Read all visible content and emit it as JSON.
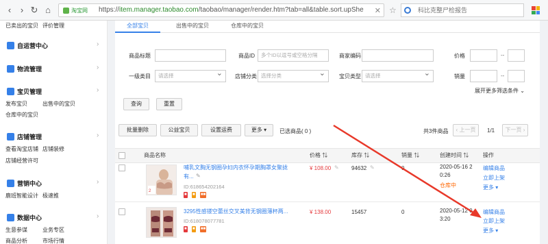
{
  "browser": {
    "site_name": "淘宝网",
    "url_prefix": "https://",
    "url_domain": "item.manager.taobao.com",
    "url_path": "/taobao/manager/render.htm?tab=all&table.sort.upShe",
    "search_text": "科比克整尸检报告"
  },
  "sidebar": {
    "top_links": [
      "已卖出的宝贝",
      "评价管理"
    ],
    "sections": [
      {
        "title": "自运营中心"
      },
      {
        "title": "物流管理"
      },
      {
        "title": "宝贝管理",
        "links": [
          "发布宝贝",
          "出售中的宝贝",
          "仓库中的宝贝"
        ]
      },
      {
        "title": "店铺管理",
        "links": [
          "查看淘宝店铺",
          "店铺装修",
          "店铺经营许可"
        ]
      },
      {
        "title": "营销中心",
        "links": [
          "鹿班智能设计",
          "极速推"
        ]
      },
      {
        "title": "数据中心",
        "links": [
          "生意参谋",
          "业务专区",
          "商品分析",
          "市场行情"
        ]
      }
    ]
  },
  "tabs": [
    "全部宝贝",
    "出售中的宝贝",
    "仓库中的宝贝"
  ],
  "filters": {
    "title_label": "商品标题",
    "id_label": "商品ID",
    "id_placeholder": "多个ID以逗号或空格分隔",
    "code_label": "商家编码",
    "price_label": "价格",
    "category_label": "一级类目",
    "category_placeholder": "请选择",
    "shop_cat_label": "店铺分类",
    "shop_cat_placeholder": "选择分类",
    "type_label": "宝贝类型",
    "type_placeholder": "请选择",
    "sales_label": "销量",
    "range_dash": "--",
    "expand_label": "展开更多筛选条件"
  },
  "buttons": {
    "query": "查询",
    "reset": "重置",
    "batch_delete": "批量删除",
    "public_welfare": "公益宝贝",
    "set_freight": "设置运费",
    "more": "更多",
    "selected": "已选商品( 0 )",
    "total": "共3件商品",
    "prev": "上一页",
    "page": "1/1",
    "next": "下一页"
  },
  "table": {
    "headers": {
      "name": "商品名称",
      "price": "价格",
      "stock": "库存",
      "sales": "销量",
      "created": "创建时间",
      "ops": "操作"
    },
    "rows": [
      {
        "title_line1": "哺乳文胸无钢圈孕妇内衣怀孕期胸罩女聚拢",
        "title_line2": "有...",
        "id": "ID:618654202164",
        "price": "¥ 108.00",
        "stock": "94632",
        "sales": "0",
        "created_date": "2020-05-16 2",
        "created_time": "0:26",
        "status": "仓库中",
        "ops": [
          "编辑商品",
          "立即上架",
          "更多"
        ]
      },
      {
        "title_line1": "3295性感镂空蕾丝交叉美背无钢圈薄杯两...",
        "title_line2": "",
        "id": "ID:618078077781",
        "price": "¥ 138.00",
        "stock": "15457",
        "sales": "0",
        "created_date": "2020-05-12 0",
        "created_time": "3:20",
        "status": "",
        "ops": [
          "编辑商品",
          "立即上架",
          "更多"
        ]
      }
    ]
  },
  "colors": {
    "accent": "#3580e8",
    "price": "#e4393c",
    "status": "#ff6600",
    "annotation_arrow": "#e8392a"
  }
}
